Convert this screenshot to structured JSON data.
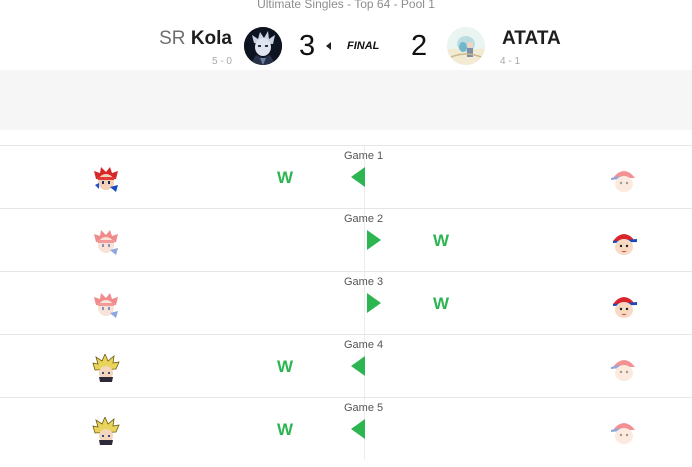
{
  "event": {
    "title": "Ultimate Singles - Top 64 - Pool 1"
  },
  "player1": {
    "prefix": "SR",
    "tag": "Kola",
    "record": "5 - 0",
    "score": "3"
  },
  "player2": {
    "tag": "ATATA",
    "record": "4 - 1",
    "score": "2"
  },
  "result": {
    "status": "FINAL"
  },
  "games": [
    {
      "label": "Game 1",
      "winner": "left",
      "win_label": "W",
      "p1_char": "roy",
      "p2_char": "ness"
    },
    {
      "label": "Game 2",
      "winner": "right",
      "win_label": "W",
      "p1_char": "roy",
      "p2_char": "ness"
    },
    {
      "label": "Game 3",
      "winner": "right",
      "win_label": "W",
      "p1_char": "roy",
      "p2_char": "ness"
    },
    {
      "label": "Game 4",
      "winner": "left",
      "win_label": "W",
      "p1_char": "cloud",
      "p2_char": "ness"
    },
    {
      "label": "Game 5",
      "winner": "left",
      "win_label": "W",
      "p1_char": "cloud",
      "p2_char": "ness"
    }
  ],
  "colors": {
    "win": "#2db552",
    "accent_text": "#1e1e1e"
  }
}
